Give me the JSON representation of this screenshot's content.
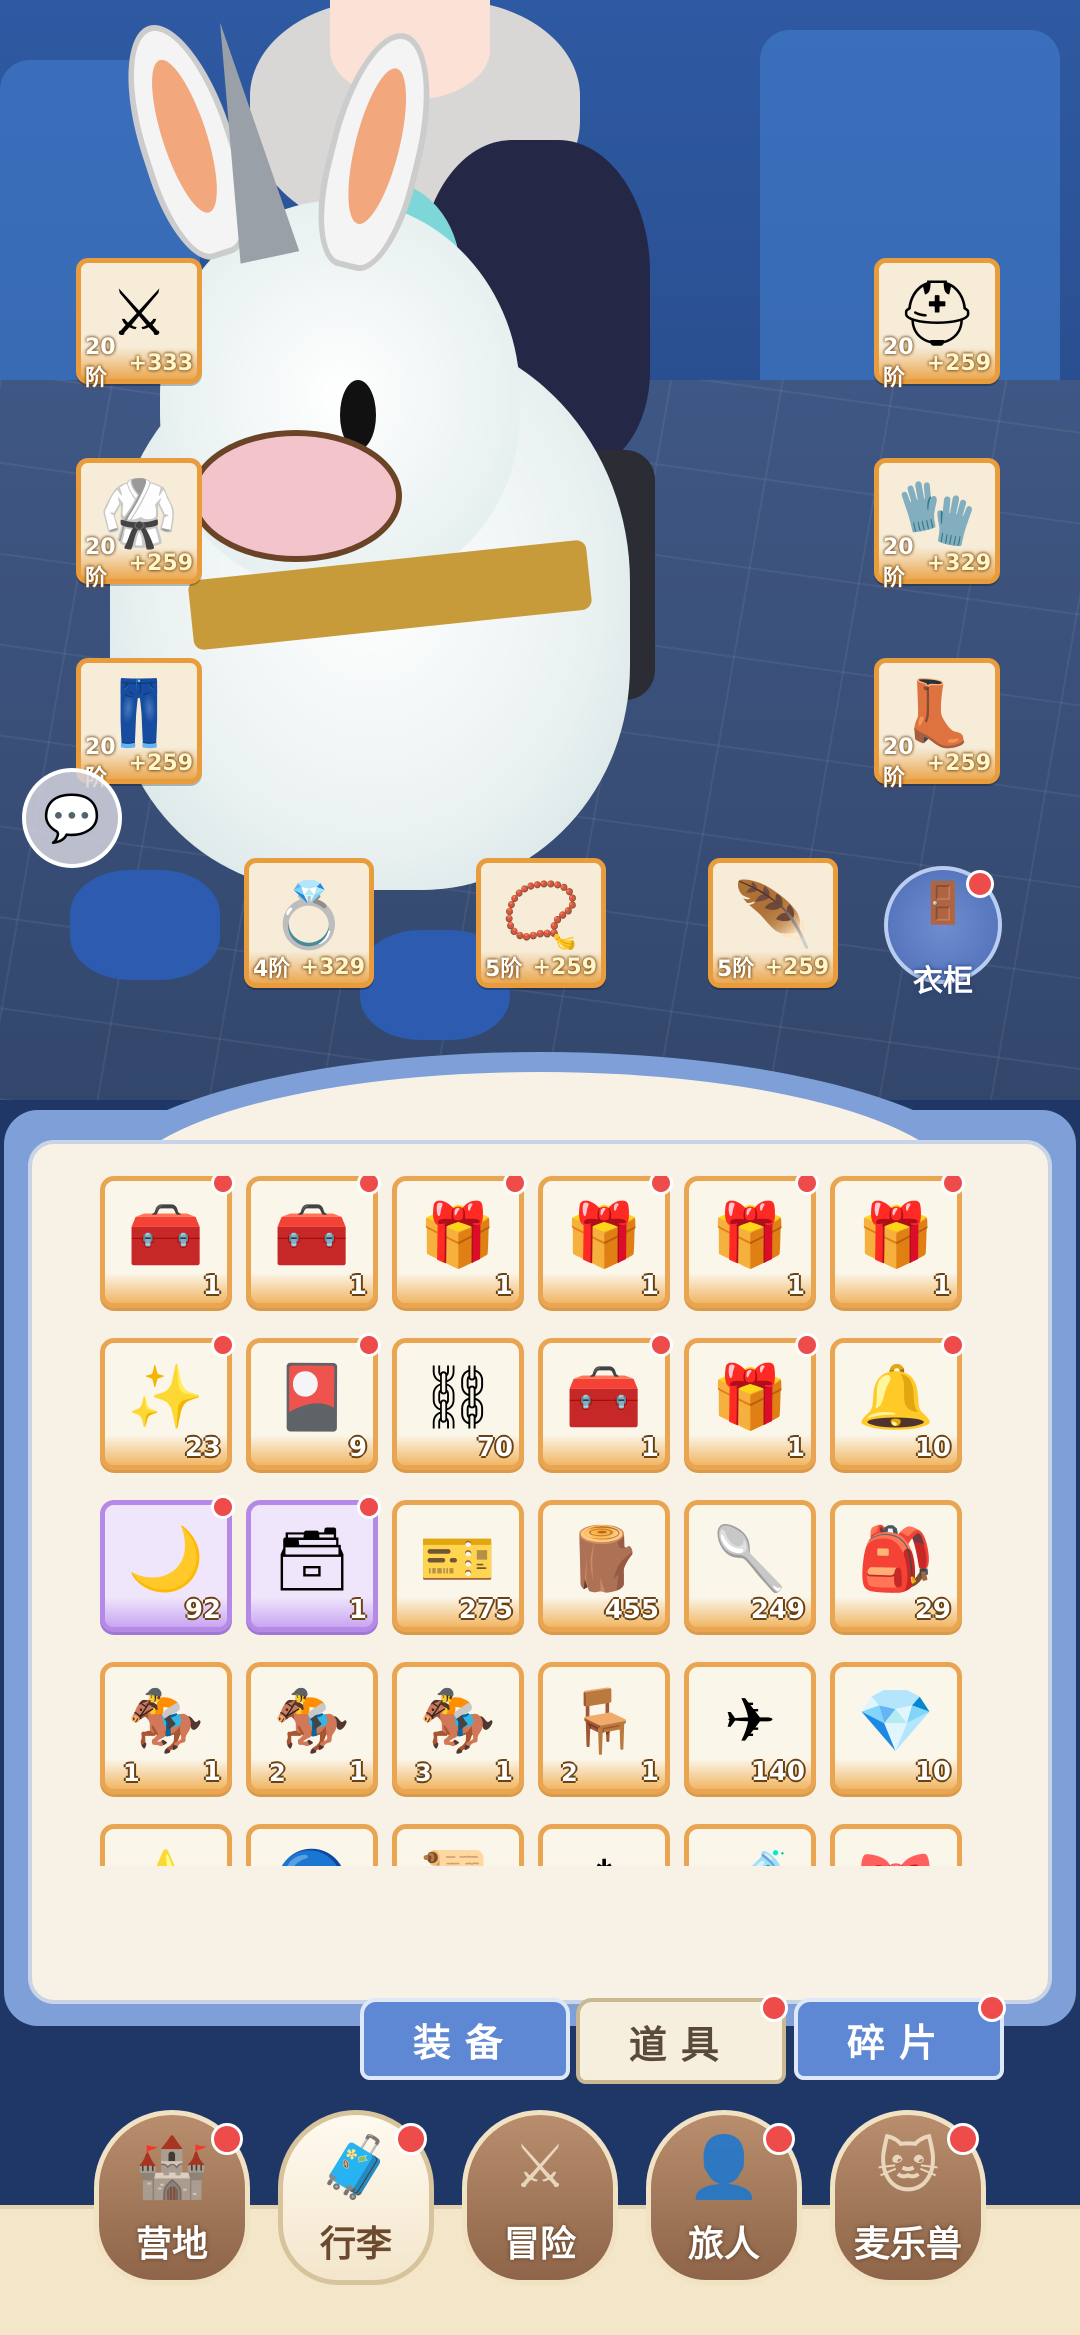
{
  "equipment": {
    "left": [
      {
        "icon": "weapon-icon",
        "glyph": "⚔",
        "level": "20阶",
        "plus": "+333"
      },
      {
        "icon": "armor-icon",
        "glyph": "🥋",
        "level": "20阶",
        "plus": "+259"
      },
      {
        "icon": "pants-icon",
        "glyph": "👖",
        "level": "20阶",
        "plus": "+259"
      }
    ],
    "right": [
      {
        "icon": "helmet-icon",
        "glyph": "⛑",
        "level": "20阶",
        "plus": "+259"
      },
      {
        "icon": "gloves-icon",
        "glyph": "🧤",
        "level": "20阶",
        "plus": "+329"
      },
      {
        "icon": "boots-icon",
        "glyph": "👢",
        "level": "20阶",
        "plus": "+259"
      }
    ],
    "accessories": [
      {
        "icon": "ring-icon",
        "glyph": "💍",
        "level": "4阶",
        "plus": "+329"
      },
      {
        "icon": "necklace-icon",
        "glyph": "📿",
        "level": "5阶",
        "plus": "+259"
      },
      {
        "icon": "charm-icon",
        "glyph": "🪶",
        "level": "5阶",
        "plus": "+259"
      }
    ]
  },
  "wardrobe_label": "衣柜",
  "items": [
    {
      "icon": "wooden-chest-icon",
      "glyph": "🧰",
      "count": "1",
      "rare": "gold"
    },
    {
      "icon": "wooden-chest-icon",
      "glyph": "🧰",
      "count": "1",
      "rare": "gold"
    },
    {
      "icon": "ornate-chest-icon",
      "glyph": "🎁",
      "count": "1",
      "rare": "gold"
    },
    {
      "icon": "ornate-chest-icon",
      "glyph": "🎁",
      "count": "1",
      "rare": "gold"
    },
    {
      "icon": "ornate-chest-icon",
      "glyph": "🎁",
      "count": "1",
      "rare": "gold"
    },
    {
      "icon": "ornate-chest-icon",
      "glyph": "🎁",
      "count": "1",
      "rare": "gold"
    },
    {
      "icon": "gold-shard-icon",
      "glyph": "✨",
      "count": "23",
      "rare": "gold"
    },
    {
      "icon": "red-card-icon",
      "glyph": "🎴",
      "count": "9",
      "rare": "gold"
    },
    {
      "icon": "metal-ore-icon",
      "glyph": "⛓",
      "count": "70",
      "rare": "gold"
    },
    {
      "icon": "wooden-chest-icon",
      "glyph": "🧰",
      "count": "1",
      "rare": "gold"
    },
    {
      "icon": "ornate-chest-icon",
      "glyph": "🎁",
      "count": "1",
      "rare": "gold"
    },
    {
      "icon": "bell-icon",
      "glyph": "🔔",
      "count": "10",
      "rare": "gold"
    },
    {
      "icon": "purple-shard-icon",
      "glyph": "🌙",
      "count": "92",
      "rare": "purple"
    },
    {
      "icon": "silver-chest-icon",
      "glyph": "🗃",
      "count": "1",
      "rare": "purple"
    },
    {
      "icon": "ticket-icon",
      "glyph": "🎫",
      "count": "275",
      "rare": "gold"
    },
    {
      "icon": "log-icon",
      "glyph": "🪵",
      "count": "455",
      "rare": "gold"
    },
    {
      "icon": "spoon-icon",
      "glyph": "🥄",
      "count": "249",
      "rare": "gold"
    },
    {
      "icon": "seed-bag-icon",
      "glyph": "🎒",
      "count": "29",
      "rare": "gold"
    },
    {
      "icon": "saddle-icon",
      "glyph": "🏇",
      "count": "1",
      "level": "1",
      "rare": "gold"
    },
    {
      "icon": "saddle-icon",
      "glyph": "🏇",
      "count": "1",
      "level": "2",
      "rare": "gold"
    },
    {
      "icon": "saddle-icon",
      "glyph": "🏇",
      "count": "1",
      "level": "3",
      "rare": "gold"
    },
    {
      "icon": "stool-icon",
      "glyph": "🪑",
      "count": "1",
      "level": "2",
      "rare": "gold"
    },
    {
      "icon": "paper-plane-icon",
      "glyph": "✈",
      "count": "140",
      "rare": "gold"
    },
    {
      "icon": "gold-crystal-icon",
      "glyph": "💎",
      "count": "10",
      "rare": "gold"
    },
    {
      "icon": "star-icon",
      "glyph": "⭐",
      "count": "",
      "rare": "gold"
    },
    {
      "icon": "blue-orb-icon",
      "glyph": "🔵",
      "count": "",
      "rare": "gold"
    },
    {
      "icon": "scroll-icon",
      "glyph": "📜",
      "count": "",
      "rare": "gold"
    },
    {
      "icon": "ice-crystal-icon",
      "glyph": "❄",
      "count": "",
      "rare": "gold"
    },
    {
      "icon": "potion-icon",
      "glyph": "🧪",
      "count": "",
      "rare": "gold"
    },
    {
      "icon": "gift-icon",
      "glyph": "🎀",
      "count": "",
      "rare": "gold"
    }
  ],
  "tabs": [
    {
      "label": "装备",
      "active": false,
      "dot": false
    },
    {
      "label": "道具",
      "active": true,
      "dot": true
    },
    {
      "label": "碎片",
      "active": false,
      "dot": true
    }
  ],
  "nav": [
    {
      "label": "营地",
      "icon": "castle-icon",
      "glyph": "🏰",
      "active": false
    },
    {
      "label": "行李",
      "icon": "luggage-icon",
      "glyph": "🧳",
      "active": true
    },
    {
      "label": "冒险",
      "icon": "swords-icon",
      "glyph": "⚔",
      "active": false
    },
    {
      "label": "旅人",
      "icon": "traveler-icon",
      "glyph": "👤",
      "active": false
    },
    {
      "label": "麦乐兽",
      "icon": "cat-icon",
      "glyph": "🐱",
      "active": false
    }
  ]
}
